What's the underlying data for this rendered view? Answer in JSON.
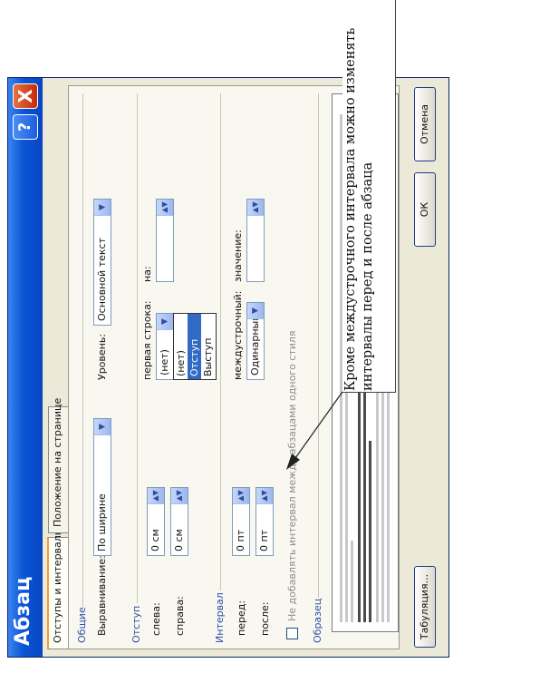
{
  "dialog": {
    "title": "Абзац",
    "help_label": "?",
    "close_label": "X",
    "tabs": [
      {
        "label": "Отступы и интервалы",
        "active": true
      },
      {
        "label": "Положение на странице",
        "active": false
      }
    ],
    "general": {
      "group_label": "Общие",
      "alignment_label": "Выравнивание:",
      "alignment_value": "По ширине",
      "level_label": "Уровень:",
      "level_value": "Основной текст"
    },
    "indent": {
      "group_label": "Отступ",
      "left_label": "слева:",
      "left_value": "0 см",
      "right_label": "справа:",
      "right_value": "0 см",
      "first_line_label": "первая строка:",
      "first_line_value": "(нет)",
      "by_label": "на:",
      "first_line_options": [
        "(нет)",
        "Отступ",
        "Выступ"
      ],
      "first_line_selected_index": 1
    },
    "spacing": {
      "group_label": "Интервал",
      "before_label": "перед:",
      "before_value": "0 пт",
      "after_label": "после:",
      "after_value": "0 пт",
      "line_spacing_label": "междустрочный:",
      "line_spacing_value": "Одинарный",
      "value_label": "значение:",
      "no_add_checkbox_label": "Не добавлять интервал между абзацами одного стиля",
      "no_add_checked": false
    },
    "preview": {
      "group_label": "Образец"
    },
    "buttons": {
      "tabs_label": "Табуляция...",
      "ok_label": "ОК",
      "cancel_label": "Отмена"
    }
  },
  "annotation": {
    "text": "Кроме междустрочного интервала можно изменять интервалы перед и после абзаца"
  },
  "colors": {
    "titlebar": "#0a54d6",
    "close_button": "#c4290c",
    "dialog_background": "#ece9d8",
    "selection": "#316ac5"
  }
}
